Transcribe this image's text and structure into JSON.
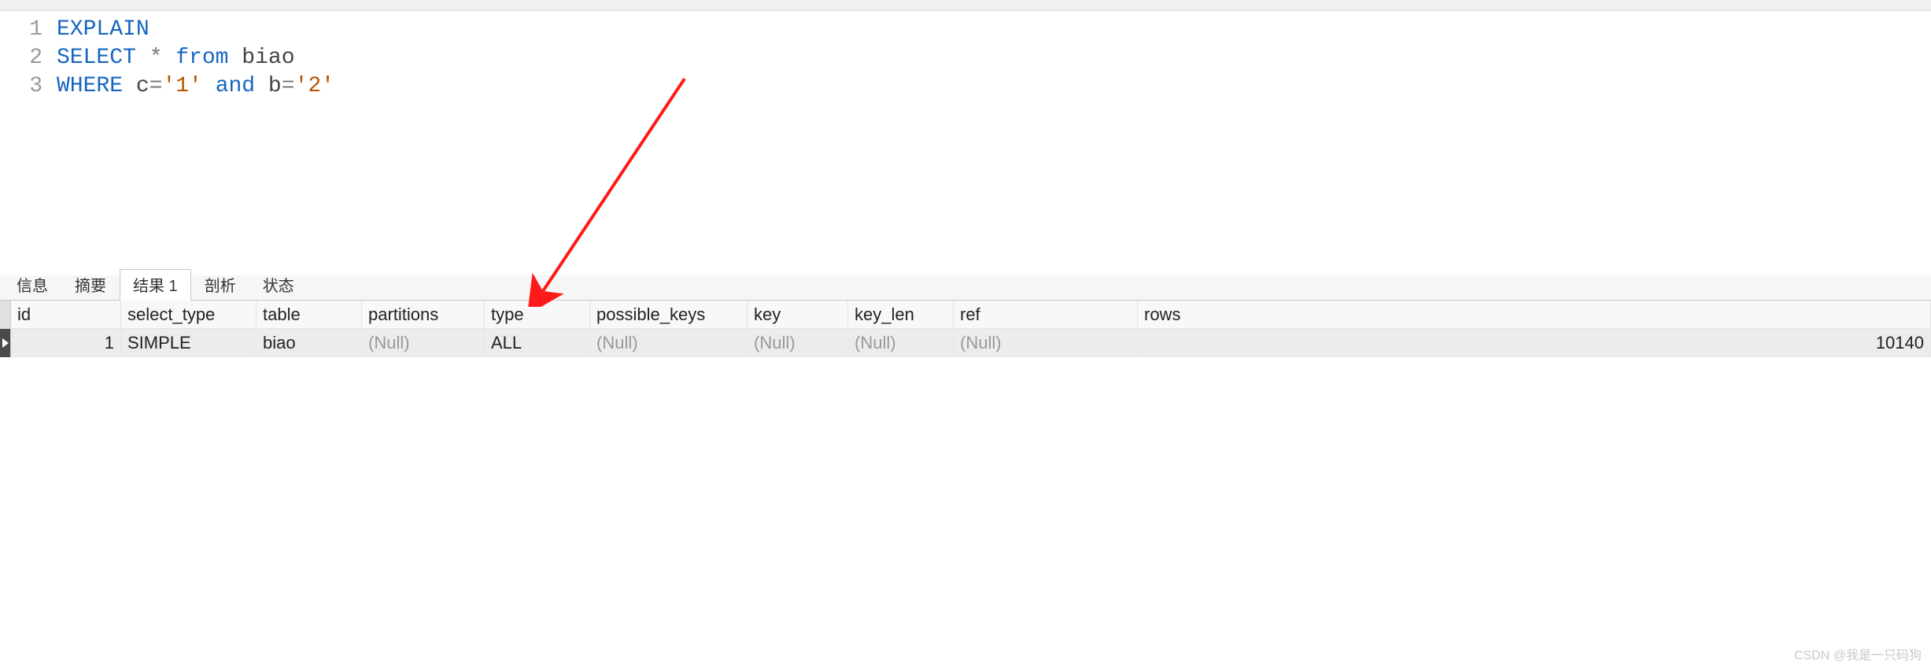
{
  "editor": {
    "lines": [
      {
        "n": "1",
        "tokens": [
          {
            "t": "EXPLAIN",
            "c": "kw"
          }
        ]
      },
      {
        "n": "2",
        "tokens": [
          {
            "t": "SELECT",
            "c": "kw"
          },
          {
            "t": " ",
            "c": ""
          },
          {
            "t": "*",
            "c": "op"
          },
          {
            "t": " ",
            "c": ""
          },
          {
            "t": "from",
            "c": "kw"
          },
          {
            "t": " ",
            "c": ""
          },
          {
            "t": "biao",
            "c": "ident"
          }
        ]
      },
      {
        "n": "3",
        "tokens": [
          {
            "t": "WHERE",
            "c": "kw"
          },
          {
            "t": " ",
            "c": ""
          },
          {
            "t": "c",
            "c": "ident"
          },
          {
            "t": "=",
            "c": "op"
          },
          {
            "t": "'1'",
            "c": "str"
          },
          {
            "t": " ",
            "c": ""
          },
          {
            "t": "and",
            "c": "kw"
          },
          {
            "t": " ",
            "c": ""
          },
          {
            "t": "b",
            "c": "ident"
          },
          {
            "t": "=",
            "c": "op"
          },
          {
            "t": "'2'",
            "c": "str"
          }
        ]
      }
    ]
  },
  "tabs": {
    "items": [
      {
        "label": "信息",
        "active": false
      },
      {
        "label": "摘要",
        "active": false
      },
      {
        "label": "结果 1",
        "active": true
      },
      {
        "label": "剖析",
        "active": false
      },
      {
        "label": "状态",
        "active": false
      }
    ]
  },
  "result": {
    "columns": [
      "id",
      "select_type",
      "table",
      "partitions",
      "type",
      "possible_keys",
      "key",
      "key_len",
      "ref",
      "rows"
    ],
    "rows": [
      {
        "id": "1",
        "select_type": "SIMPLE",
        "table": "biao",
        "partitions": "(Null)",
        "type": "ALL",
        "possible_keys": "(Null)",
        "key": "(Null)",
        "key_len": "(Null)",
        "ref": "(Null)",
        "rows": "10140"
      }
    ]
  },
  "watermark": "CSDN @我是一只码狗"
}
